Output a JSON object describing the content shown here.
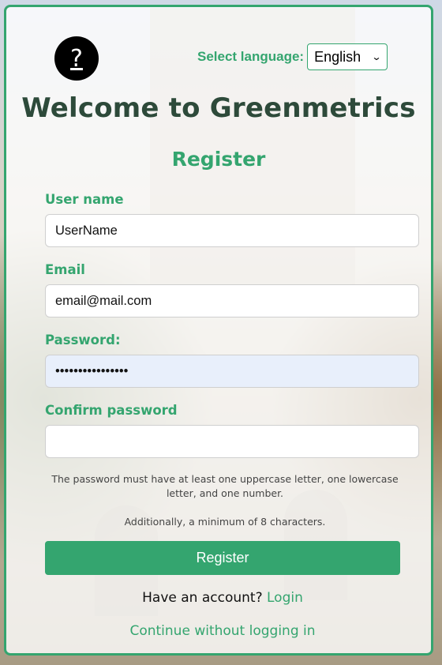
{
  "header": {
    "help_icon_glyph": "?",
    "language_label": "Select language:",
    "language_selected": "English"
  },
  "title": "Welcome to Greenmetrics",
  "subtitle": "Register",
  "form": {
    "username": {
      "label": "User name",
      "value": "UserName"
    },
    "email": {
      "label": "Email",
      "value": "email@mail.com"
    },
    "password": {
      "label": "Password:",
      "value": "••••••••••••••••"
    },
    "confirm_password": {
      "label": "Confirm password",
      "value": ""
    }
  },
  "hints": {
    "rule": "The password must have at least one uppercase letter, one lowercase letter, and one number.",
    "min_length": "Additionally, a minimum of 8 characters."
  },
  "register_button": "Register",
  "account_prompt": "Have an account?",
  "login_link": "Login",
  "continue_link": "Continue without logging in",
  "colors": {
    "accent": "#34a56f",
    "title": "#2d4a3a"
  }
}
